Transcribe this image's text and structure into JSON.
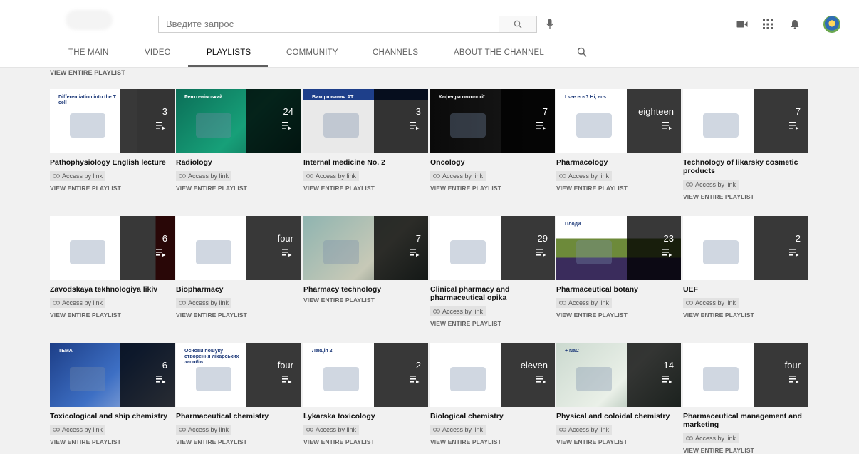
{
  "search": {
    "placeholder": "Введите запрос"
  },
  "tabs": [
    {
      "label": "THE MAIN"
    },
    {
      "label": "VIDEO"
    },
    {
      "label": "PLAYLISTS",
      "active": true
    },
    {
      "label": "COMMUNITY"
    },
    {
      "label": "CHANNELS"
    },
    {
      "label": "ABOUT THE CHANNEL"
    }
  ],
  "top_link": "VIEW ENTIRE PLAYLIST",
  "access_label": "Access by link",
  "view_label": "VIEW ENTIRE PLAYLIST",
  "playlists": [
    {
      "title": "Pathophysiology English lecture",
      "count": "3",
      "thumb_text": "Differentiation into the T cell"
    },
    {
      "title": "Radiology",
      "count": "24",
      "thumb_text": "Рентгенівський"
    },
    {
      "title": "Internal medicine No. 2",
      "count": "3",
      "thumb_text": "Вимірювання АТ"
    },
    {
      "title": "Oncology",
      "count": "7",
      "thumb_text": "Кафедра онкології"
    },
    {
      "title": "Pharmacology",
      "count": "eighteen",
      "thumb_text": "I see ecs? Hi, ecs"
    },
    {
      "title": "Technology of likarsky cosmetic products",
      "count": "7",
      "thumb_text": ""
    },
    {
      "title": "Zavodskaya tekhnologiya likiv",
      "count": "6",
      "thumb_text": ""
    },
    {
      "title": "Biopharmacy",
      "count": "four",
      "thumb_text": ""
    },
    {
      "title": "Pharmacy technology",
      "count": "7",
      "thumb_text": ""
    },
    {
      "title": "Clinical pharmacy and pharmaceutical opika",
      "count": "29",
      "thumb_text": ""
    },
    {
      "title": "Pharmaceutical botany",
      "count": "23",
      "thumb_text": "Плоди"
    },
    {
      "title": "UEF",
      "count": "2",
      "thumb_text": ""
    },
    {
      "title": "Toxicological and ship chemistry",
      "count": "6",
      "thumb_text": "ТЕМА"
    },
    {
      "title": "Pharmaceutical chemistry",
      "count": "four",
      "thumb_text": "Основи пошуку створення лікарських засобів"
    },
    {
      "title": "Lykarska toxicology",
      "count": "2",
      "thumb_text": "Лекція 2"
    },
    {
      "title": "Biological chemistry",
      "count": "eleven",
      "thumb_text": ""
    },
    {
      "title": "Physical and coloidal chemistry",
      "count": "14",
      "thumb_text": "+ NaC"
    },
    {
      "title": "Pharmaceutical management and marketing",
      "count": "four",
      "thumb_text": ""
    }
  ]
}
